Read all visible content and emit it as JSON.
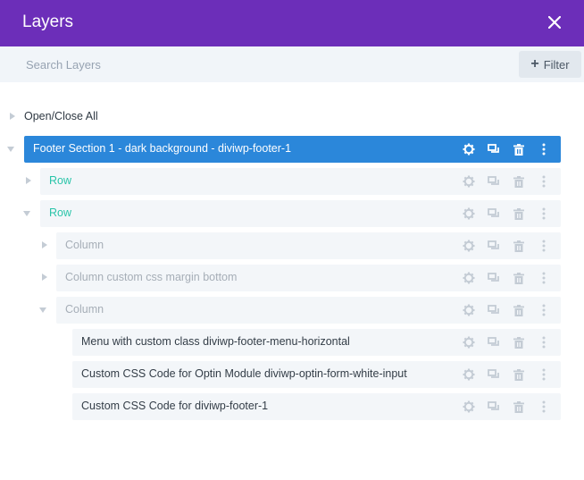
{
  "panel": {
    "title": "Layers"
  },
  "search": {
    "placeholder": "Search Layers"
  },
  "filter": {
    "label": "Filter"
  },
  "tree": {
    "open_close_all": "Open/Close All",
    "section": {
      "label": "Footer Section 1 - dark background - diviwp-footer-1"
    },
    "row_1": {
      "label": "Row"
    },
    "row_2": {
      "label": "Row"
    },
    "column_1": {
      "label": "Column"
    },
    "column_2": {
      "label": "Column custom css margin bottom"
    },
    "column_3": {
      "label": "Column"
    },
    "module_1": {
      "label": "Menu with custom class diviwp-footer-menu-horizontal"
    },
    "module_2": {
      "label": "Custom CSS Code for Optin Module diviwp-optin-form-white-input"
    },
    "module_3": {
      "label": "Custom CSS Code for diviwp-footer-1"
    }
  },
  "colors": {
    "header": "#6c2eb9",
    "section": "#2b87da",
    "row_text": "#29c4a9",
    "column_text": "#a6aeb7"
  }
}
